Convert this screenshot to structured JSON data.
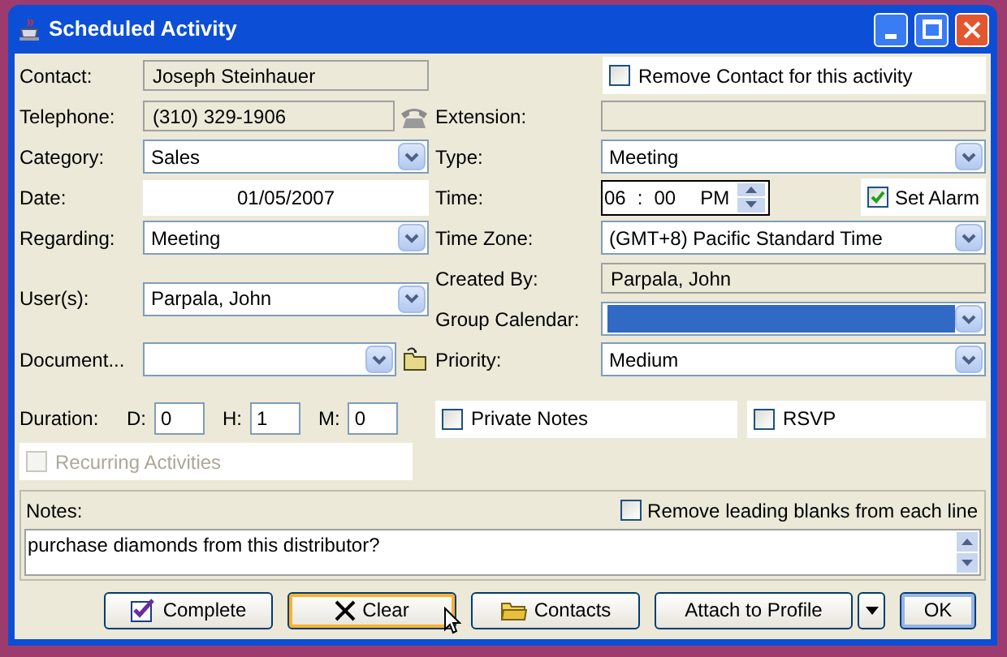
{
  "window": {
    "title": "Scheduled Activity"
  },
  "left_fields": [
    {
      "kind": "readonly",
      "label": "Contact:",
      "value": "Joseph Steinhauer"
    },
    {
      "kind": "phone",
      "label": "Telephone:",
      "value": "(310) 329-1906"
    },
    {
      "kind": "dropdown",
      "label": "Category:",
      "value": "Sales"
    },
    {
      "kind": "date",
      "label": "Date:",
      "value": "01/05/2007"
    },
    {
      "kind": "dropdown",
      "label": "Regarding:",
      "value": "Meeting"
    },
    {
      "kind": "dropdown",
      "label": "User(s):",
      "value": "Parpala, John"
    },
    {
      "kind": "document",
      "label": "Document..."
    }
  ],
  "right_fields": [
    {
      "kind": "checkbox",
      "label": "Remove Contact for this activity",
      "checked": false
    },
    {
      "kind": "readonly",
      "label": "Extension:"
    },
    {
      "kind": "dropdown",
      "label": "Type:",
      "value": "Meeting",
      "highlighted": false
    },
    {
      "kind": "time",
      "label": "Time:",
      "hour": "06",
      "separator": ":",
      "minute": "00",
      "ampm": "PM",
      "alarm": {
        "label": "Set Alarm",
        "checked": true
      }
    },
    {
      "kind": "dropdown",
      "label": "Time Zone:",
      "value": "(GMT+8) Pacific Standard Time",
      "highlighted": false
    },
    {
      "kind": "readonly",
      "label": "Created By:",
      "value": "Parpala, John"
    },
    {
      "kind": "dropdown",
      "label": "Group Calendar:",
      "highlighted": true
    },
    {
      "kind": "dropdown",
      "label": "Priority:",
      "value": "Medium",
      "highlighted": false
    }
  ],
  "duration": {
    "label": "Duration:",
    "parts": [
      {
        "label": "D:",
        "value": "0"
      },
      {
        "label": "H:",
        "value": "1"
      },
      {
        "label": "M:",
        "value": "0"
      }
    ]
  },
  "private_notes": {
    "label": "Private Notes",
    "checked": false
  },
  "rsvp": {
    "label": "RSVP",
    "checked": false
  },
  "recurring": {
    "label": "Recurring Activities",
    "checked": false,
    "disabled": true
  },
  "notes": {
    "label": "Notes:",
    "remove_blanks": {
      "label": "Remove leading blanks from each line",
      "checked": false
    },
    "text": "purchase diamonds from this distributor?"
  },
  "buttons": [
    {
      "kind": "complete",
      "label": "Complete",
      "focused": false
    },
    {
      "kind": "clear",
      "label": "Clear",
      "focused": true
    },
    {
      "kind": "contacts",
      "label": "Contacts",
      "focused": false
    },
    {
      "kind": "plain",
      "label": "Attach to Profile",
      "focused": false
    },
    {
      "kind": "menu",
      "focused": false
    },
    {
      "kind": "default",
      "label": "OK",
      "focused": false
    }
  ]
}
